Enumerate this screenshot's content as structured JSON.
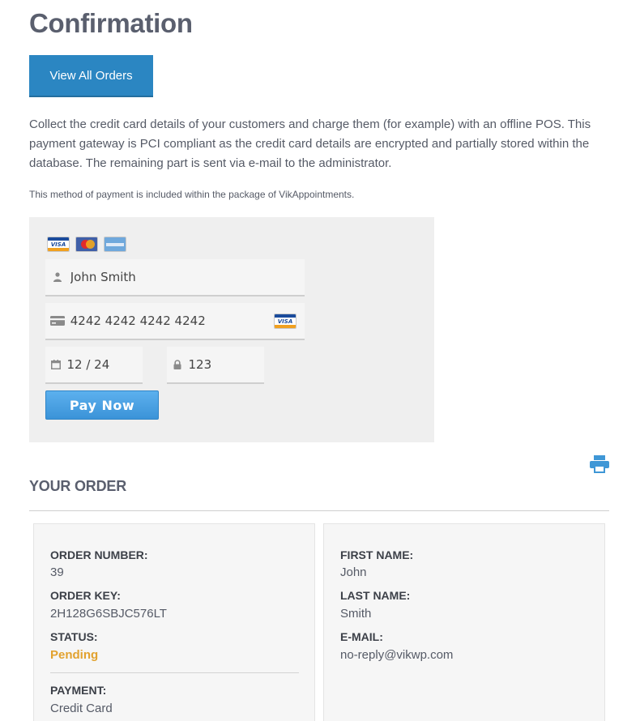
{
  "page": {
    "title": "Confirmation",
    "view_orders_label": "View All Orders",
    "intro_text": "Collect the credit card details of your customers and charge them (for example) with an offline POS. This payment gateway is PCI compliant as the credit card details are encrypted and partially stored within the database. The remaining part is sent via e-mail to the administrator.",
    "intro_note": "This method of payment is included within the package of VikAppointments."
  },
  "payment_form": {
    "accepted_cards": [
      "visa-card-icon",
      "mastercard-card-icon",
      "amex-card-icon"
    ],
    "cardholder_name": "John Smith",
    "card_number": "4242 4242 4242 4242",
    "expiry": "12 / 24",
    "cvc": "123",
    "detected_card": "visa-card-icon",
    "pay_button_label": "Pay Now",
    "visa_text": "VISA"
  },
  "order": {
    "heading": "YOUR ORDER",
    "left": {
      "order_number_label": "ORDER NUMBER:",
      "order_number": "39",
      "order_key_label": "ORDER KEY:",
      "order_key": "2H128G6SBJC576LT",
      "status_label": "STATUS:",
      "status": "Pending",
      "payment_label": "PAYMENT:",
      "payment": "Credit Card"
    },
    "right": {
      "first_name_label": "FIRST NAME:",
      "first_name": "John",
      "last_name_label": "LAST NAME:",
      "last_name": "Smith",
      "email_label": "E-MAIL:",
      "email": "no-reply@vikwp.com"
    }
  },
  "colors": {
    "primary_button": "#2b86c2",
    "pay_button": "#3b93d8",
    "status_pending": "#e2a22f",
    "print_icon": "#3f97d6"
  }
}
